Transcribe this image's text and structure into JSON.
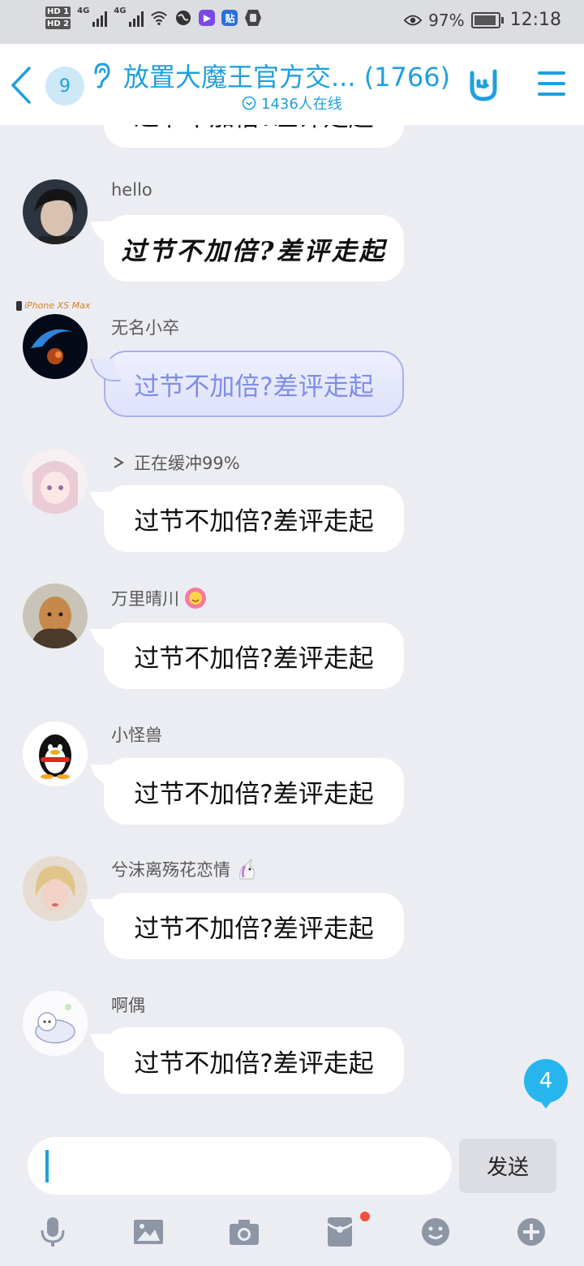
{
  "status_bar": {
    "hd1": "HD 1",
    "hd2": "HD 2",
    "network1": "4G",
    "network2": "4G",
    "battery_percent": "97%",
    "time": "12:18"
  },
  "header": {
    "unread_count": "9",
    "title": "放置大魔王官方交... (1766)",
    "online_text": "1436人在线"
  },
  "messages": [
    {
      "sender": "hello",
      "text": "过节不加倍?差评走起"
    },
    {
      "sender": "无名小卒",
      "device": "iPhone XS Max",
      "text": "过节不加倍?差评走起"
    },
    {
      "sender": "正在缓冲99%",
      "text": "过节不加倍?差评走起"
    },
    {
      "sender": "万里晴川",
      "text": "过节不加倍?差评走起"
    },
    {
      "sender": "小怪兽",
      "text": "过节不加倍?差评走起"
    },
    {
      "sender": "兮沫离殇花恋情",
      "text": "过节不加倍?差评走起"
    },
    {
      "sender": "啊偶",
      "text": "过节不加倍?差评走起"
    }
  ],
  "partial_top_message": "过节不加倍?差评走起",
  "new_message_count": "4",
  "input": {
    "value": "",
    "send_label": "发送"
  },
  "toolbar": [
    "microphone-icon",
    "image-icon",
    "camera-icon",
    "red-packet-icon",
    "emoji-icon",
    "plus-icon"
  ],
  "colors": {
    "accent": "#1fa0dd",
    "background": "#ebedf3",
    "special_bubble_text": "#7f8ee6",
    "badge": "#27b5ee"
  }
}
